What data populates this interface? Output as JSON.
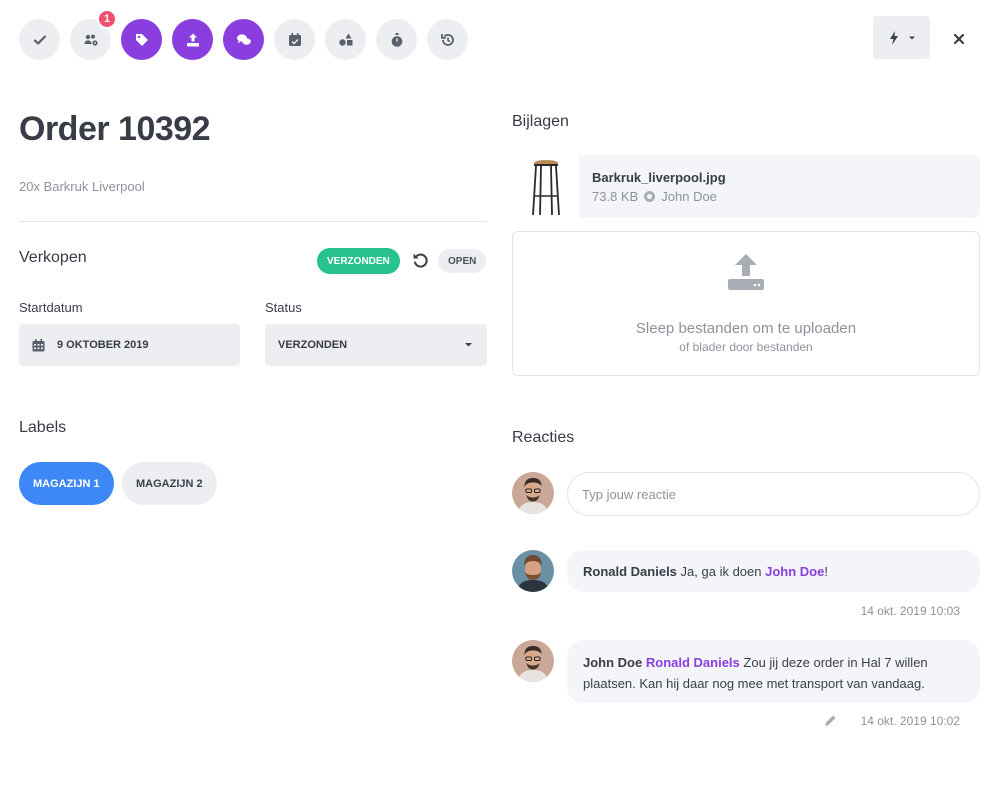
{
  "toolbar": {
    "buttons": [
      {
        "icon": "check-icon"
      },
      {
        "icon": "users-cog-icon",
        "badge": "1"
      },
      {
        "icon": "tag-icon"
      },
      {
        "icon": "upload-icon"
      },
      {
        "icon": "comments-icon"
      },
      {
        "icon": "calendar-check-icon"
      },
      {
        "icon": "shapes-icon"
      },
      {
        "icon": "stopwatch-icon"
      },
      {
        "icon": "history-icon"
      }
    ]
  },
  "order": {
    "title": "Order 10392",
    "subtitle": "20x Barkruk Liverpool"
  },
  "sales": {
    "heading": "Verkopen",
    "status_pill": "VERZONDEN",
    "open_pill": "OPEN",
    "start_label": "Startdatum",
    "start_value": "9 OKTOBER 2019",
    "status_label": "Status",
    "status_value": "VERZONDEN"
  },
  "labels": {
    "heading": "Labels",
    "items": [
      "MAGAZIJN 1",
      "MAGAZIJN 2"
    ]
  },
  "attachments": {
    "heading": "Bijlagen",
    "file": {
      "name": "Barkruk_liverpool.jpg",
      "size": "73.8 KB",
      "owner": "John Doe"
    },
    "dropzone": {
      "main": "Sleep bestanden om te uploaden",
      "sub": "of blader door bestanden"
    }
  },
  "comments": {
    "heading": "Reacties",
    "placeholder": "Typ jouw reactie",
    "items": [
      {
        "author": "Ronald Daniels",
        "text_before": "Ja, ga ik doen",
        "mention": "John Doe",
        "text_after": "!",
        "time": "14 okt. 2019 10:03"
      },
      {
        "author": "John Doe",
        "mention": "Ronald Daniels",
        "text_after": "Zou jij deze order in Hal 7 willen plaatsen. Kan hij daar nog mee met transport van vandaag.",
        "time": "14 okt. 2019 10:02"
      }
    ]
  },
  "colors": {
    "accent": "#8a3ee0",
    "success": "#27c28e",
    "primary": "#3d88f6",
    "badge": "#f0506e"
  }
}
